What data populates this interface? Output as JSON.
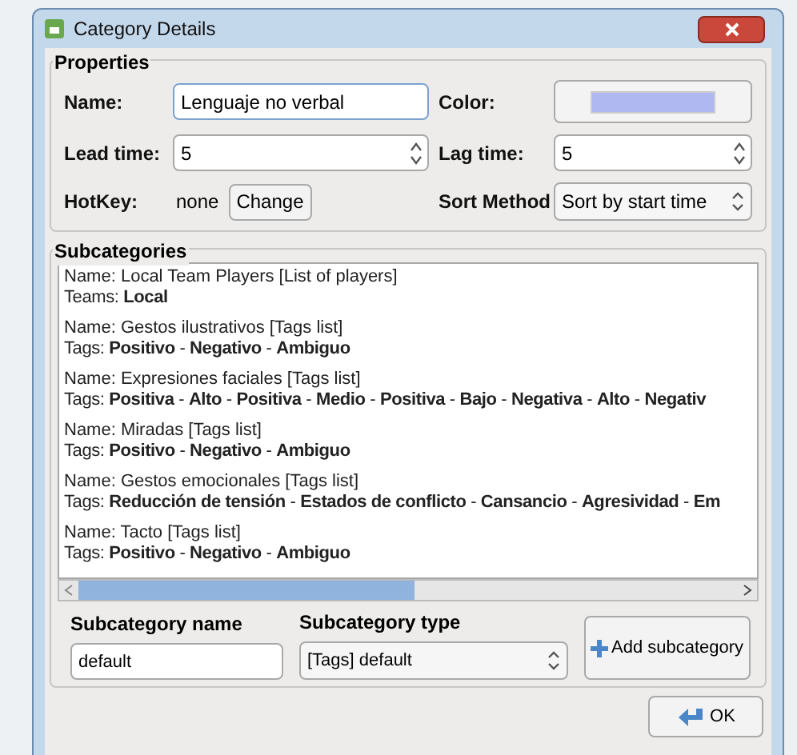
{
  "window": {
    "title": "Category Details"
  },
  "properties": {
    "title": "Properties",
    "name": {
      "label": "Name:",
      "value": "Lenguaje no verbal"
    },
    "color": {
      "label": "Color:",
      "color": "#b0b8f2"
    },
    "lead_time": {
      "label": "Lead time:",
      "value": "5"
    },
    "lag_time": {
      "label": "Lag time:",
      "value": "5"
    },
    "hotkey": {
      "label": "HotKey:",
      "value": "none",
      "button": "Change"
    },
    "sort_method": {
      "label": "Sort Method",
      "value": "Sort by start time"
    }
  },
  "subcategories": {
    "title": "Subcategories",
    "items": [
      {
        "name": "Name: Local Team Players [List of players]",
        "detail": "Teams: **Local**"
      },
      {
        "name": "Name: Gestos ilustrativos [Tags list]",
        "detail": "Tags: **Positivo** - **Negativo** - **Ambiguo**"
      },
      {
        "name": "Name: Expresiones faciales [Tags list]",
        "detail": "Tags: **Positiva** - **Alto** - **Positiva** - **Medio** - **Positiva** - **Bajo** - **Negativa** - **Alto** - **Negativ**"
      },
      {
        "name": "Name: Miradas [Tags list]",
        "detail": "Tags: **Positivo** - **Negativo** - **Ambiguo**"
      },
      {
        "name": "Name: Gestos emocionales [Tags list]",
        "detail": "Tags: **Reducción de tensión** - **Estados de conflicto** - **Cansancio** - **Agresividad** - **Em**"
      },
      {
        "name": "Name: Tacto [Tags list]",
        "detail": "Tags: **Positivo** - **Negativo** - **Ambiguo**"
      }
    ],
    "new_name": {
      "label": "Subcategory name",
      "value": "default"
    },
    "new_type": {
      "label": "Subcategory type",
      "value": "[Tags] default"
    },
    "add_button": "Add subcategory"
  },
  "buttons": {
    "ok": "OK"
  }
}
